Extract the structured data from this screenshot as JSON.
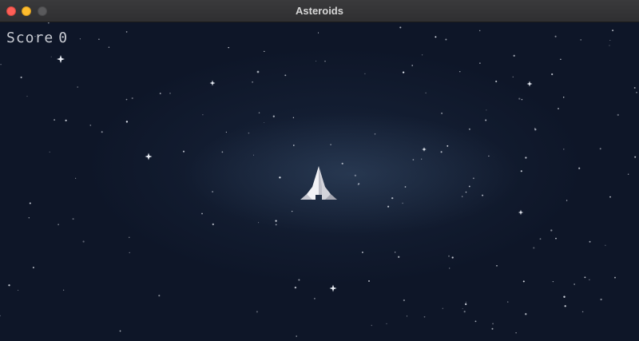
{
  "window": {
    "title": "Asteroids",
    "controls": {
      "close_color": "#fe5f57",
      "minimize_color": "#febc2e",
      "zoom_color": "#5a5a5c"
    }
  },
  "hud": {
    "score_label": "Score",
    "score_value": "0"
  },
  "colors": {
    "space_background": "#0e1628",
    "star": "#e8ecf4",
    "ship_light": "#f2f2f6",
    "ship_mid": "#cfd0d8",
    "ship_dark": "#a9aab4",
    "hud_text": "#c9ccd3"
  },
  "icons": {
    "ship": "player-spaceship-icon",
    "star": "star-sparkle-icon"
  }
}
